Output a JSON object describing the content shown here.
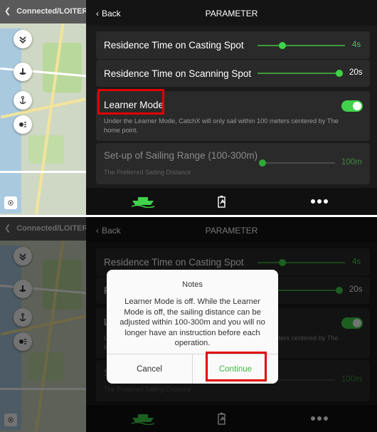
{
  "status_bar": {
    "connection_label": "Connected/LOITER"
  },
  "header": {
    "back_label": "Back",
    "title": "PARAMETER"
  },
  "settings": {
    "casting": {
      "label": "Residence Time on Casting Spot",
      "value": "4s"
    },
    "scanning": {
      "label": "Residence Time on Scanning Spot",
      "value": "20s"
    },
    "learner": {
      "label": "Learner Mode",
      "description": "Under the Learner Mode, CatchX will only sail within 100 meters centered by The home point.",
      "enabled": true
    },
    "range": {
      "label": "Set-up of Sailing Range (100-300m)",
      "sublabel": "The Preferred Sailing Distance",
      "value": "100m"
    }
  },
  "tabs": [
    {
      "icon": "boat-icon"
    },
    {
      "icon": "battery-icon"
    },
    {
      "icon": "more-icon"
    }
  ],
  "dialog": {
    "title": "Notes",
    "message": "Learner Mode is off. While the Learner Mode is off, the sailing distance can be adjusted within 100-300m and you will no longer have an instruction before each operation.",
    "cancel_label": "Cancel",
    "continue_label": "Continue"
  },
  "colors": {
    "accent": "#3fd24a",
    "highlight": "#e00000",
    "panel": "#2a2a2a"
  }
}
